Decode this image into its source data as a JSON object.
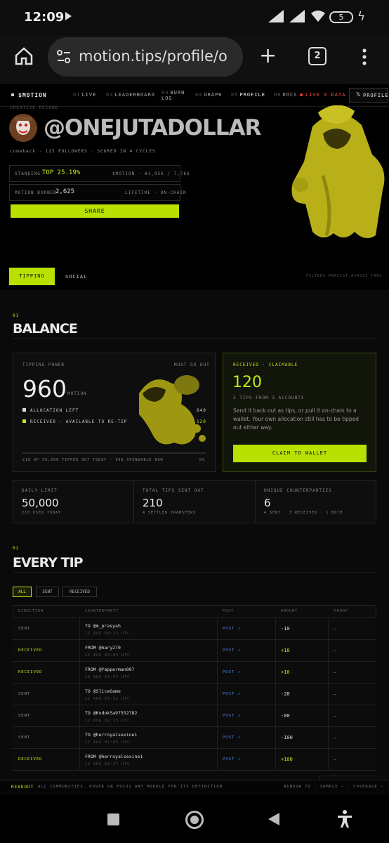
{
  "status": {
    "time": "12:09",
    "battery": "5"
  },
  "browser": {
    "url": "motion.tips/profile/o",
    "tab_count": "2"
  },
  "site": {
    "logo": "$MOTION",
    "nav": [
      {
        "num": "01",
        "label": "LIVE"
      },
      {
        "num": "02",
        "label": "LEADERBOARD"
      },
      {
        "num": "03",
        "label": "BURN LOG"
      },
      {
        "num": "04",
        "label": "GRAPH"
      },
      {
        "num": "05",
        "label": "PROFILE"
      },
      {
        "num": "06",
        "label": "DOCS"
      }
    ],
    "live_label": "LIVE X DATA",
    "x_profile": "PROFILE"
  },
  "profile": {
    "kicker": "CREATIVE RECORD",
    "handle": "@ONEJUTADOLLAR",
    "meta": "comeback · 123 FOLLOWERS · SCORED IN 4 CYCLES",
    "standing_label": "STANDING",
    "standing_value": "TOP 25.19%",
    "standing_right": "$MOTION · #1,956 / 7,766",
    "burned_label": "MOTION BURNED",
    "burned_value": "2,625",
    "burned_right": "LIFETIME · ON-CHAIN",
    "share": "SHARE"
  },
  "tabs": {
    "tipping": "TIPPING",
    "social": "SOCIAL",
    "note": "FILTERS PERSIST ACROSS TABS"
  },
  "balance": {
    "num": "01",
    "title": "BALANCE",
    "power_label": "TIPPING POWER",
    "power_right": "MUST GO OUT",
    "power_value": "960",
    "power_unit": "MOTION",
    "alloc_label": "ALLOCATION LEFT",
    "alloc_value": "840",
    "recv_label": "RECEIVED · AVAILABLE TO RE-TIP",
    "recv_value": "120",
    "bar_caption": "210 OF 50,000 TIPPED OUT TODAY · 960 SPENDABLE NOW",
    "bar_pct": "0%",
    "claim_label": "RECEIVED · CLAIMABLE",
    "claim_value": "120",
    "claim_sub": "3 TIPS FROM 3 ACCOUNTS",
    "claim_text": "Send it back out as tips, or pull it on-chain to a wallet. Your own allocation still has to be tipped out either way.",
    "claim_button": "CLAIM TO WALLET"
  },
  "stats": [
    {
      "label": "DAILY LIMIT",
      "value": "50,000",
      "sub": "210 USED TODAY"
    },
    {
      "label": "TOTAL TIPS SENT OUT",
      "value": "210",
      "sub": "4 SETTLED TRANSFERS"
    },
    {
      "label": "UNIQUE COUNTERPARTIES",
      "value": "6",
      "sub": "4 SENT · 3 RECEIVED · 1 BOTH"
    }
  ],
  "tips": {
    "num": "02",
    "title": "EVERY TIP",
    "filters": [
      "ALL",
      "SENT",
      "RECEIVED"
    ],
    "headers": [
      "DIRECTION",
      "COUNTERPARTY",
      "POST",
      "AMOUNT",
      "PROOF"
    ],
    "rows": [
      {
        "dir": "SENT",
        "who": "TO @m_prasyah",
        "when": "12 AUG 04:13 UTC",
        "post": "POST ↗",
        "amount": "-10",
        "proof": "—"
      },
      {
        "dir": "RECEIVED",
        "who": "FROM @hary270",
        "when": "12 AUG 04:03 UTC",
        "post": "POST ↗",
        "amount": "+10",
        "proof": "—"
      },
      {
        "dir": "RECEIVED",
        "who": "FROM @Yapperman007",
        "when": "12 AUG 02:57 UTC",
        "post": "POST ↗",
        "amount": "+10",
        "proof": "—"
      },
      {
        "dir": "SENT",
        "who": "TO @SliceGame",
        "when": "12 AUG 02:52 UTC",
        "post": "POST ↗",
        "amount": "-20",
        "proof": "—"
      },
      {
        "dir": "SENT",
        "who": "TO @Kodok5a97552782",
        "when": "12 AUG 02:25 UTC",
        "post": "POST ↗",
        "amount": "-80",
        "proof": "—"
      },
      {
        "dir": "SENT",
        "who": "TO @herroyalsexine1",
        "when": "12 AUG 01:05 UTC",
        "post": "POST ↗",
        "amount": "-100",
        "proof": "—"
      },
      {
        "dir": "RECEIVED",
        "who": "FROM @herroyalsexine1",
        "when": "12 AUG 00:47 UTC",
        "post": "POST ↗",
        "amount": "+100",
        "proof": "—"
      }
    ]
  },
  "readout": {
    "label": "READOUT",
    "text": "ALL COMMUNITIES. HOVER OR FOCUS ANY MODULE FOR ITS DEFINITION",
    "right": "WINDOW 7D · SAMPLE — · COVERAGE —"
  },
  "colors": {
    "accent": "#c3e81a",
    "live": "#ff3b3b",
    "link": "#4a8cff"
  }
}
